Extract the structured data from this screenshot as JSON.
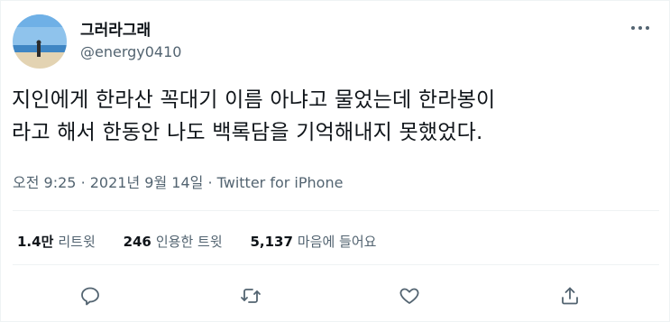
{
  "tweet": {
    "display_name": "그러라그래",
    "handle": "@energy0410",
    "text_lines": [
      "지인에게 한라산 꼭대기 이름 아냐고 물었는데 한라봉이",
      "라고 해서 한동안 나도 백록담을 기억해내지 못했었다."
    ],
    "meta": {
      "time": "오전 9:25",
      "date": "2021년 9월 14일",
      "source": "Twitter for iPhone",
      "separator": "·"
    },
    "stats": {
      "retweets_value": "1.4만",
      "retweets_label": "리트윗",
      "quotes_value": "246",
      "quotes_label": "인용한 트윗",
      "likes_value": "5,137",
      "likes_label": "마음에 들어요"
    },
    "actions": [
      "reply-icon",
      "retweet-icon",
      "like-icon",
      "share-icon"
    ],
    "more_icon": "more-horizontal-icon"
  },
  "colors": {
    "text_primary": "#0f1419",
    "text_secondary": "#536471",
    "divider": "#eff3f4"
  }
}
